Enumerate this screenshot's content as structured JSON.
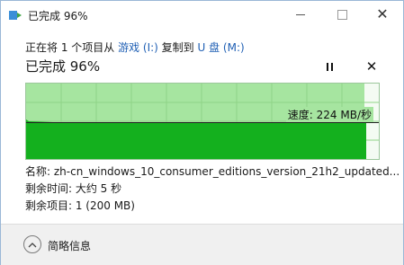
{
  "window": {
    "title": "已完成 96%",
    "icon": "file-copy-icon"
  },
  "copy_line": {
    "prefix": "正在将 1 个项目从 ",
    "source": "游戏 (I:)",
    "middle": " 复制到 ",
    "destination": "U 盘 (M:)"
  },
  "progress": {
    "title": "已完成 96%",
    "percent": 96
  },
  "graph": {
    "speed_label": "速度: 224 MB/秒"
  },
  "details": {
    "name": "名称: zh-cn_windows_10_consumer_editions_version_21h2_updated...",
    "time_remaining": "剩余时间: 大约 5 秒",
    "items_remaining": "剩余项目: 1 (200 MB)"
  },
  "footer": {
    "less_details_label": "简略信息"
  },
  "colors": {
    "graph_fill": "#a6e5a0",
    "graph_area": "#14b01e",
    "link": "#1f5fb4"
  }
}
